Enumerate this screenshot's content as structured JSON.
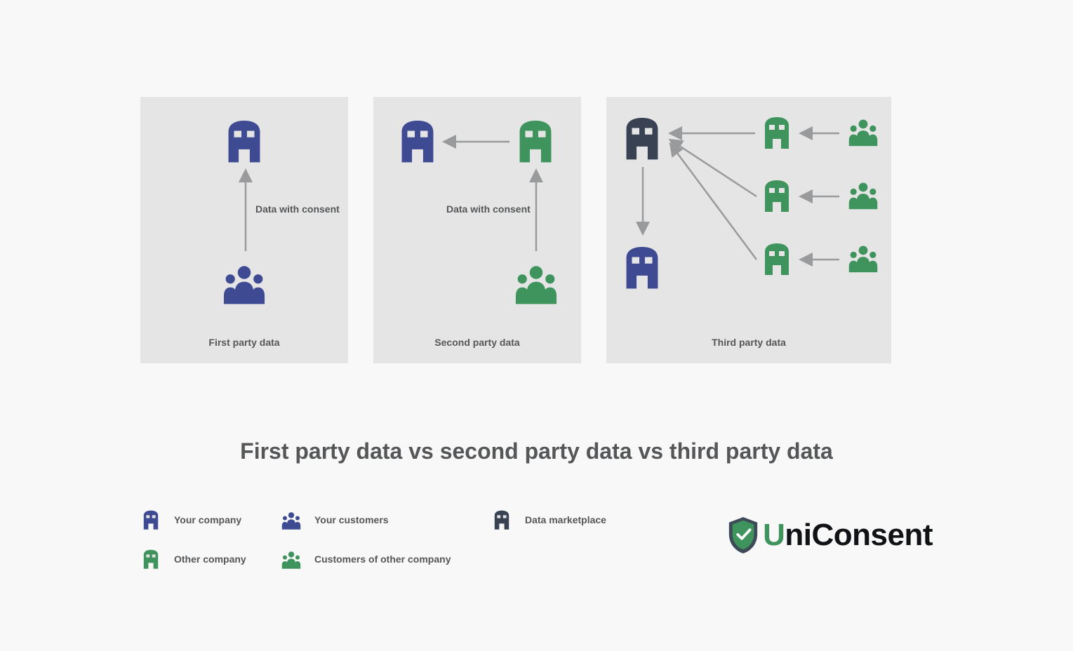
{
  "colors": {
    "blue": "#3e4a92",
    "green": "#3f935c",
    "dark": "#384252",
    "arrow": "#999a9c",
    "text": "#555658",
    "panel_bg": "#e5e5e5",
    "page_bg": "#f8f8f8"
  },
  "title": "First party data vs second party data vs third party data",
  "panels": {
    "first": {
      "caption": "First party data",
      "arrow_label": "Data with consent"
    },
    "second": {
      "caption": "Second party data",
      "arrow_label": "Data with consent"
    },
    "third": {
      "caption": "Third party data"
    }
  },
  "legend": {
    "your_company": "Your company",
    "your_customers": "Your customers",
    "data_marketplace": "Data marketplace",
    "other_company": "Other company",
    "customers_of_other_company": "Customers of other company"
  },
  "brand": {
    "name": "UniConsent",
    "prefix": "U",
    "rest": "niConsent"
  }
}
